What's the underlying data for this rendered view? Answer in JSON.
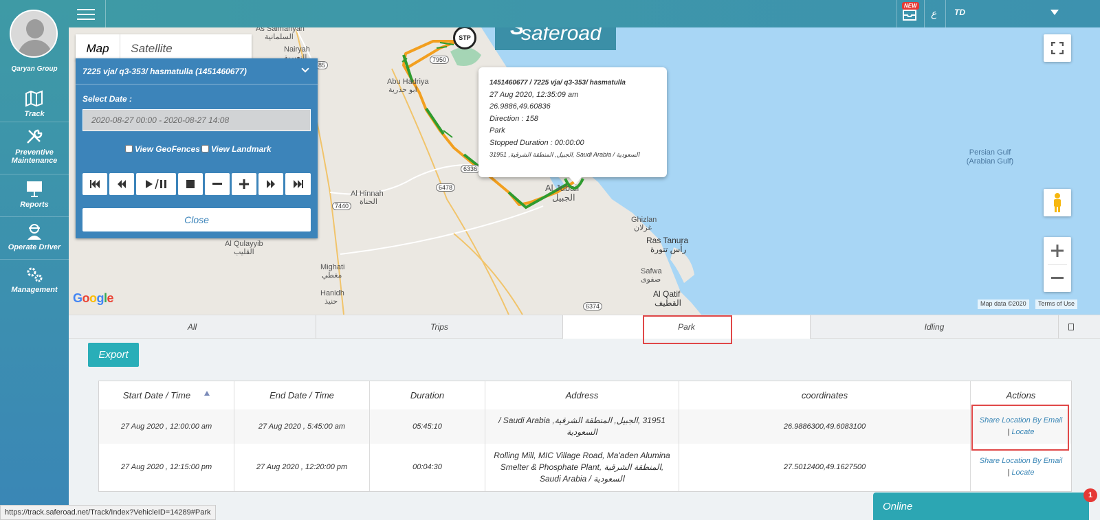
{
  "sidebar": {
    "group_name": "Qaryan Group",
    "items": [
      {
        "label": "Track",
        "icon": "map-icon"
      },
      {
        "label": "Preventive Maintenance",
        "icon": "tools-icon"
      },
      {
        "label": "Reports",
        "icon": "presentation-icon"
      },
      {
        "label": "Operate Driver",
        "icon": "driver-icon"
      },
      {
        "label": "Management",
        "icon": "gears-icon"
      }
    ]
  },
  "topbar": {
    "new_badge": "NEW",
    "language": "ع",
    "user": "TD"
  },
  "map": {
    "tabs": [
      "Map",
      "Satellite"
    ],
    "logo": "saferoad",
    "stop_marker": "STP",
    "google": "Google",
    "attribution": "Map data ©2020",
    "terms": "Terms of Use",
    "labels": {
      "as_salmanyah": "As Salmanyah",
      "as_salmanyah_ar": "السلمانية",
      "nairyah": "Nairyah",
      "nairyah_ar": "النعيرية",
      "abu_hadriya": "Abu Hadriya",
      "abu_hadriya_ar": "ابو حدرية",
      "al_hinnah": "Al Hinnah",
      "al_hinnah_ar": "الحناة",
      "al_qulayyib": "Al Qulayyib",
      "al_qulayyib_ar": "القليب",
      "mighati": "Mighati",
      "mighati_ar": "مغطي",
      "hanidh": "Hanidh",
      "hanidh_ar": "حنيذ",
      "al_jubail": "Al Jubail",
      "al_jubail_ar": "الجبيل",
      "ghizlan": "Ghizlan",
      "ghizlan_ar": "غزلان",
      "ras_tanura": "Ras Tanura",
      "ras_tanura_ar": "رأس تنورة",
      "safwa": "Safwa",
      "safwa_ar": "صفوى",
      "al_qatif": "Al Qatif",
      "al_qatif_ar": "القطيف",
      "gulf": "Persian Gulf",
      "gulf2": "(Arabian Gulf)"
    },
    "routes": [
      "7950",
      "6336",
      "6478",
      "7440",
      "6374",
      "85"
    ]
  },
  "panel": {
    "title": "7225 vja/ q3-353/ hasmatulla (1451460677)",
    "select_date_label": "Select Date :",
    "date_range": "2020-08-27 00:00 - 2020-08-27 14:08",
    "view_geofences": "View GeoFences",
    "view_landmark": "View Landmark",
    "close_label": "Close"
  },
  "popup": {
    "line1": "1451460677 / 7225 vja/ q3-353/ hasmatulla",
    "line2": "27 Aug 2020, 12:35:09 am",
    "line3": "26.9886,49.60836",
    "line4": "Direction : 158",
    "line5": "Park",
    "line6": "Stopped Duration : 00:00:00",
    "line7": "31951 ,الجبيل, المنطقة الشرقية, Saudi Arabia / السعودية"
  },
  "tabs": [
    "All",
    "Trips",
    "Park",
    "Idling"
  ],
  "export_label": "Export",
  "table": {
    "headers": [
      "Start Date / Time",
      "End Date / Time",
      "Duration",
      "Address",
      "coordinates",
      "Actions"
    ],
    "rows": [
      {
        "start": "27 Aug 2020 , 12:00:00 am",
        "end": "27 Aug 2020 , 5:45:00 am",
        "duration": "05:45:10",
        "address": "31951 ,الجبيل, المنطقة الشرقية, Saudi Arabia / السعودية",
        "coordinates": "26.9886300,49.6083100",
        "share": "Share Location By Email",
        "locate": "Locate"
      },
      {
        "start": "27 Aug 2020 , 12:15:00 pm",
        "end": "27 Aug 2020 , 12:20:00 pm",
        "duration": "00:04:30",
        "address": "Rolling Mill, MIC Village Road, Ma'aden Alumina Smelter & Phosphate Plant, المنطقة الشرقية, Saudi Arabia / السعودية",
        "coordinates": "27.5012400,49.1627500",
        "share": "Share Location By Email",
        "locate": "Locate"
      }
    ]
  },
  "status_url": "https://track.saferoad.net/Track/Index?VehicleID=14289#Park",
  "chat": {
    "label": "Online",
    "count": "1"
  }
}
